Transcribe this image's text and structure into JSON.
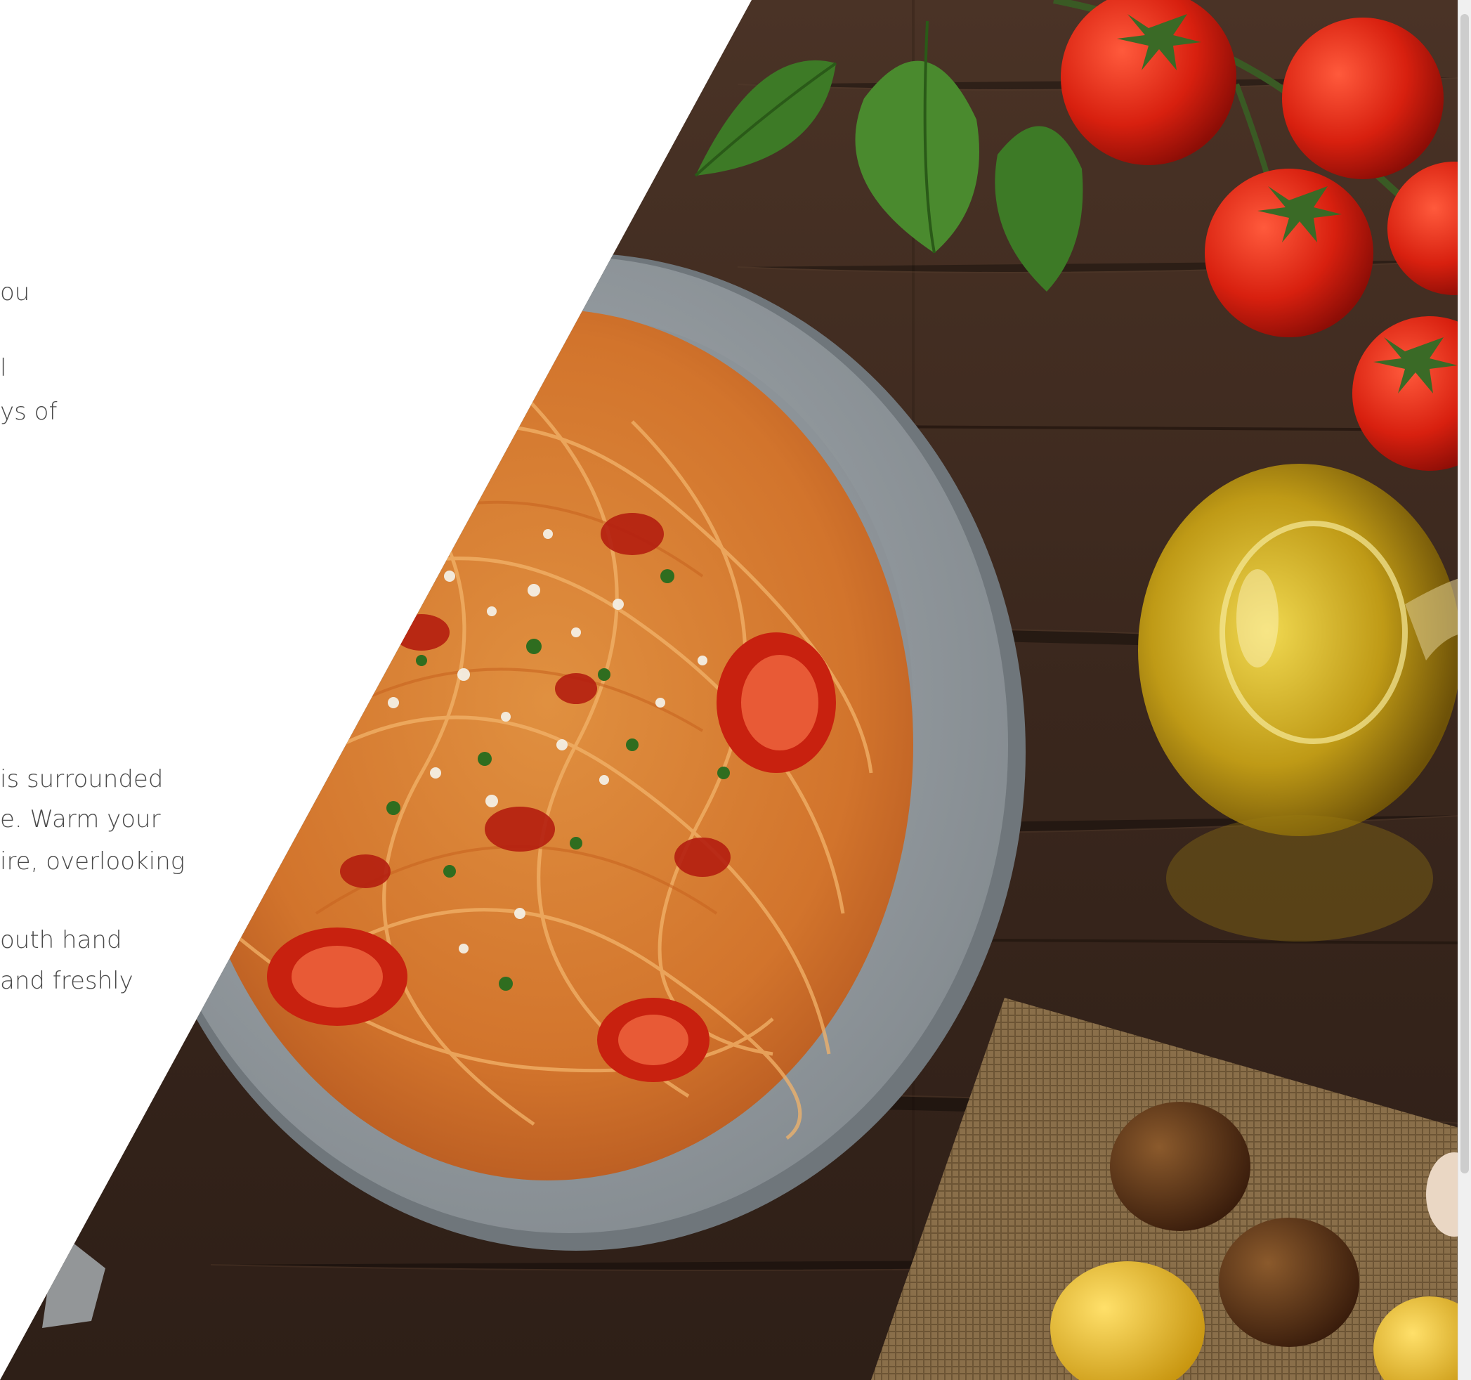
{
  "intro_text": {
    "lines": [
      "ou",
      "",
      "l",
      "ys of"
    ]
  },
  "detail_text": {
    "lines": [
      "is surrounded",
      "e. Warm your",
      "ire, overlooking",
      "",
      "outh hand",
      "and freshly"
    ]
  },
  "image": {
    "depicts": "spaghetti-plate-photo",
    "accent_colors": {
      "wood": "#3f2a1f",
      "plate": "#9aa0a4",
      "tomato": "#c81e12",
      "basil": "#3d7a26",
      "oil": "#b99a12",
      "burlap": "#8a6f4a"
    }
  },
  "scrollbar": {
    "visible": true
  }
}
